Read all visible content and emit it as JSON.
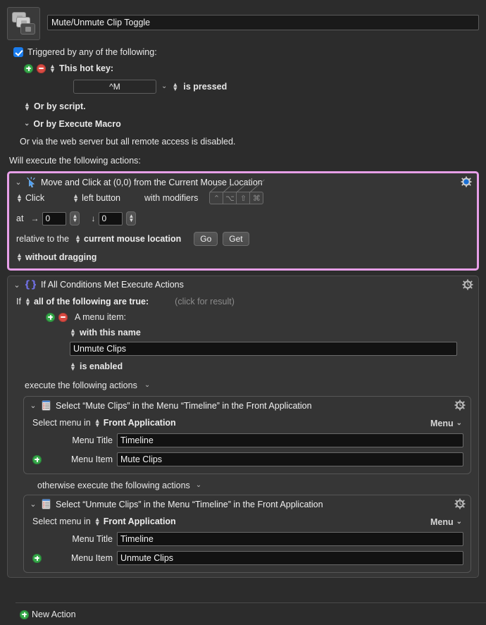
{
  "macro": {
    "icon_name": "macro-stack-icon",
    "title": "Mute/Unmute Clip Toggle"
  },
  "trigger": {
    "checkbox_label": "Triggered by any of the following:",
    "hotkey_trigger_label": "This hot key:",
    "hotkey_value": "^M",
    "hotkey_condition": "is pressed",
    "or_by_script": "Or by script.",
    "or_by_execute_macro": "Or by Execute Macro",
    "web_server_note": "Or via the web server but all remote access is disabled.",
    "will_execute": "Will execute the following actions:"
  },
  "actions": [
    {
      "id": "move-and-click",
      "title": "Move and Click at (0,0) from the Current Mouse Location",
      "icon_name": "click-cursor-icon",
      "selected": true,
      "gear_color": "#1a6fd4",
      "click_mode": "Click",
      "button": "left button",
      "with_modifiers_label": "with modifiers",
      "modifiers": [
        {
          "name": "control-modifier",
          "glyph": "⌃",
          "enabled": false
        },
        {
          "name": "option-modifier",
          "glyph": "⌥",
          "enabled": false
        },
        {
          "name": "shift-modifier",
          "glyph": "⇧",
          "enabled": false
        },
        {
          "name": "command-modifier",
          "glyph": "⌘",
          "enabled": false
        }
      ],
      "at_label": "at",
      "x_arrow": "→",
      "x_value": "0",
      "y_arrow": "↓",
      "y_value": "0",
      "relative_label": "relative to the",
      "relative_value": "current mouse location",
      "go_button": "Go",
      "get_button": "Get",
      "drag_mode": "without dragging"
    },
    {
      "id": "if-all-conditions",
      "title": "If All Conditions Met Execute Actions",
      "icon_name": "curly-braces-icon",
      "selected": false,
      "gear_color": "#b9b9b9",
      "if_label": "If",
      "match_mode": "all of the following are true:",
      "click_for_result": "(click for result)",
      "condition": {
        "type_label": "A menu item:",
        "name_mode": "with this name",
        "name_value": "Unmute Clips",
        "state_mode": "is enabled"
      },
      "then_label": "execute the following actions",
      "else_label": "otherwise execute the following actions",
      "then_actions": [
        {
          "id": "select-menu-mute",
          "title": "Select “Mute Clips” in the Menu “Timeline” in the Front Application",
          "icon_name": "menu-list-icon",
          "gear_color": "#b9b9b9",
          "select_menu_in_label": "Select menu in",
          "target": "Front Application",
          "menu_popup_label": "Menu",
          "menu_title_label": "Menu Title",
          "menu_title_value": "Timeline",
          "menu_item_label": "Menu Item",
          "menu_item_value": "Mute Clips"
        }
      ],
      "else_actions": [
        {
          "id": "select-menu-unmute",
          "title": "Select “Unmute Clips” in the Menu “Timeline” in the Front Application",
          "icon_name": "menu-list-icon",
          "gear_color": "#b9b9b9",
          "select_menu_in_label": "Select menu in",
          "target": "Front Application",
          "menu_popup_label": "Menu",
          "menu_title_label": "Menu Title",
          "menu_title_value": "Timeline",
          "menu_item_label": "Menu Item",
          "menu_item_value": "Unmute Clips"
        }
      ]
    }
  ],
  "footer": {
    "new_action_label": "New Action"
  },
  "colors": {
    "background": "#2c2c2c",
    "action_background": "#363636",
    "selection_border": "#e79fe8",
    "accent_blue": "#1a7ced",
    "green": "#36a94a",
    "red": "#d94a42"
  }
}
